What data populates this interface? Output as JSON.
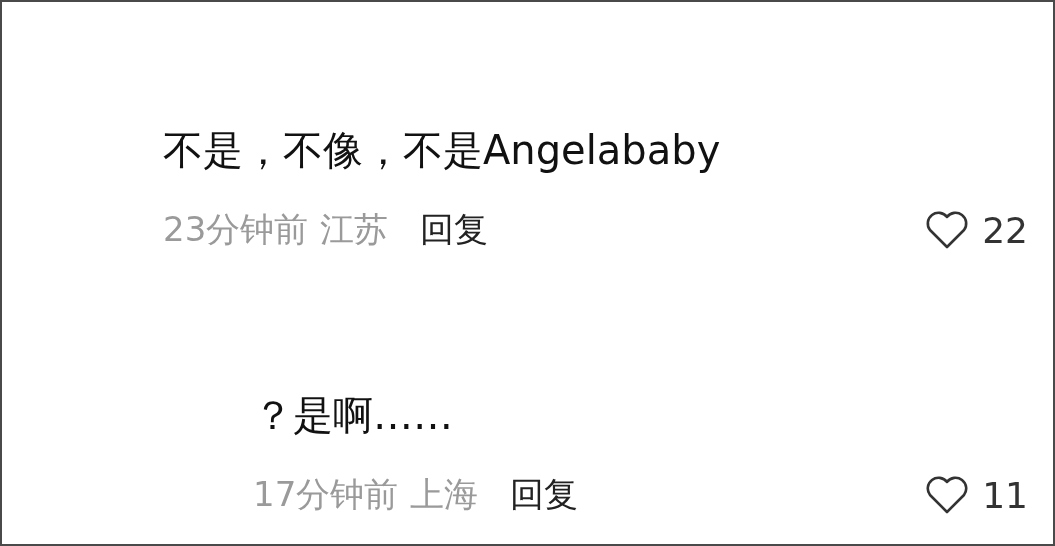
{
  "comments": [
    {
      "text": "不是，不像，不是Angelababy",
      "time": "23分钟前",
      "location": "江苏",
      "reply_label": "回复",
      "likes": "22",
      "children": [
        {
          "text": "？是啊……",
          "time": "17分钟前",
          "location": "上海",
          "reply_label": "回复",
          "likes": "11"
        }
      ]
    }
  ]
}
